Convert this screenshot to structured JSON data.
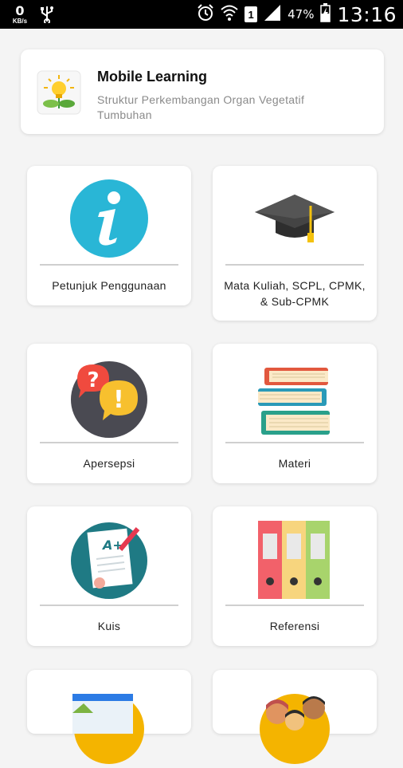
{
  "status_bar": {
    "net_speed": "0",
    "net_unit": "KB/s",
    "sim_slot": "1",
    "battery_percent": "47%",
    "time": "13:16",
    "icons": [
      "usb-icon",
      "alarm-icon",
      "wifi-icon",
      "sim-icon",
      "signal-icon",
      "battery-icon"
    ]
  },
  "header": {
    "title": "Mobile Learning",
    "subtitle": "Struktur Perkembangan Organ Vegetatif Tumbuhan",
    "logo_icon": "plant-bulb-logo"
  },
  "menu": [
    {
      "label": "Petunjuk Penggunaan",
      "icon": "info-icon"
    },
    {
      "label": "Mata Kuliah, SCPL, CPMK, & Sub-CPMK",
      "icon": "graduation-cap-icon"
    },
    {
      "label": "Apersepsi",
      "icon": "question-exclamation-icon"
    },
    {
      "label": "Materi",
      "icon": "books-icon"
    },
    {
      "label": "Kuis",
      "icon": "quiz-paper-icon"
    },
    {
      "label": "Referensi",
      "icon": "binders-icon"
    },
    {
      "label": "",
      "icon": "browser-window-icon"
    },
    {
      "label": "",
      "icon": "team-people-icon"
    }
  ],
  "colors": {
    "background": "#f4f4f4",
    "info_blue": "#29b6d6",
    "cap_gray": "#3a3a3a",
    "tassel_gold": "#f4c20d"
  }
}
